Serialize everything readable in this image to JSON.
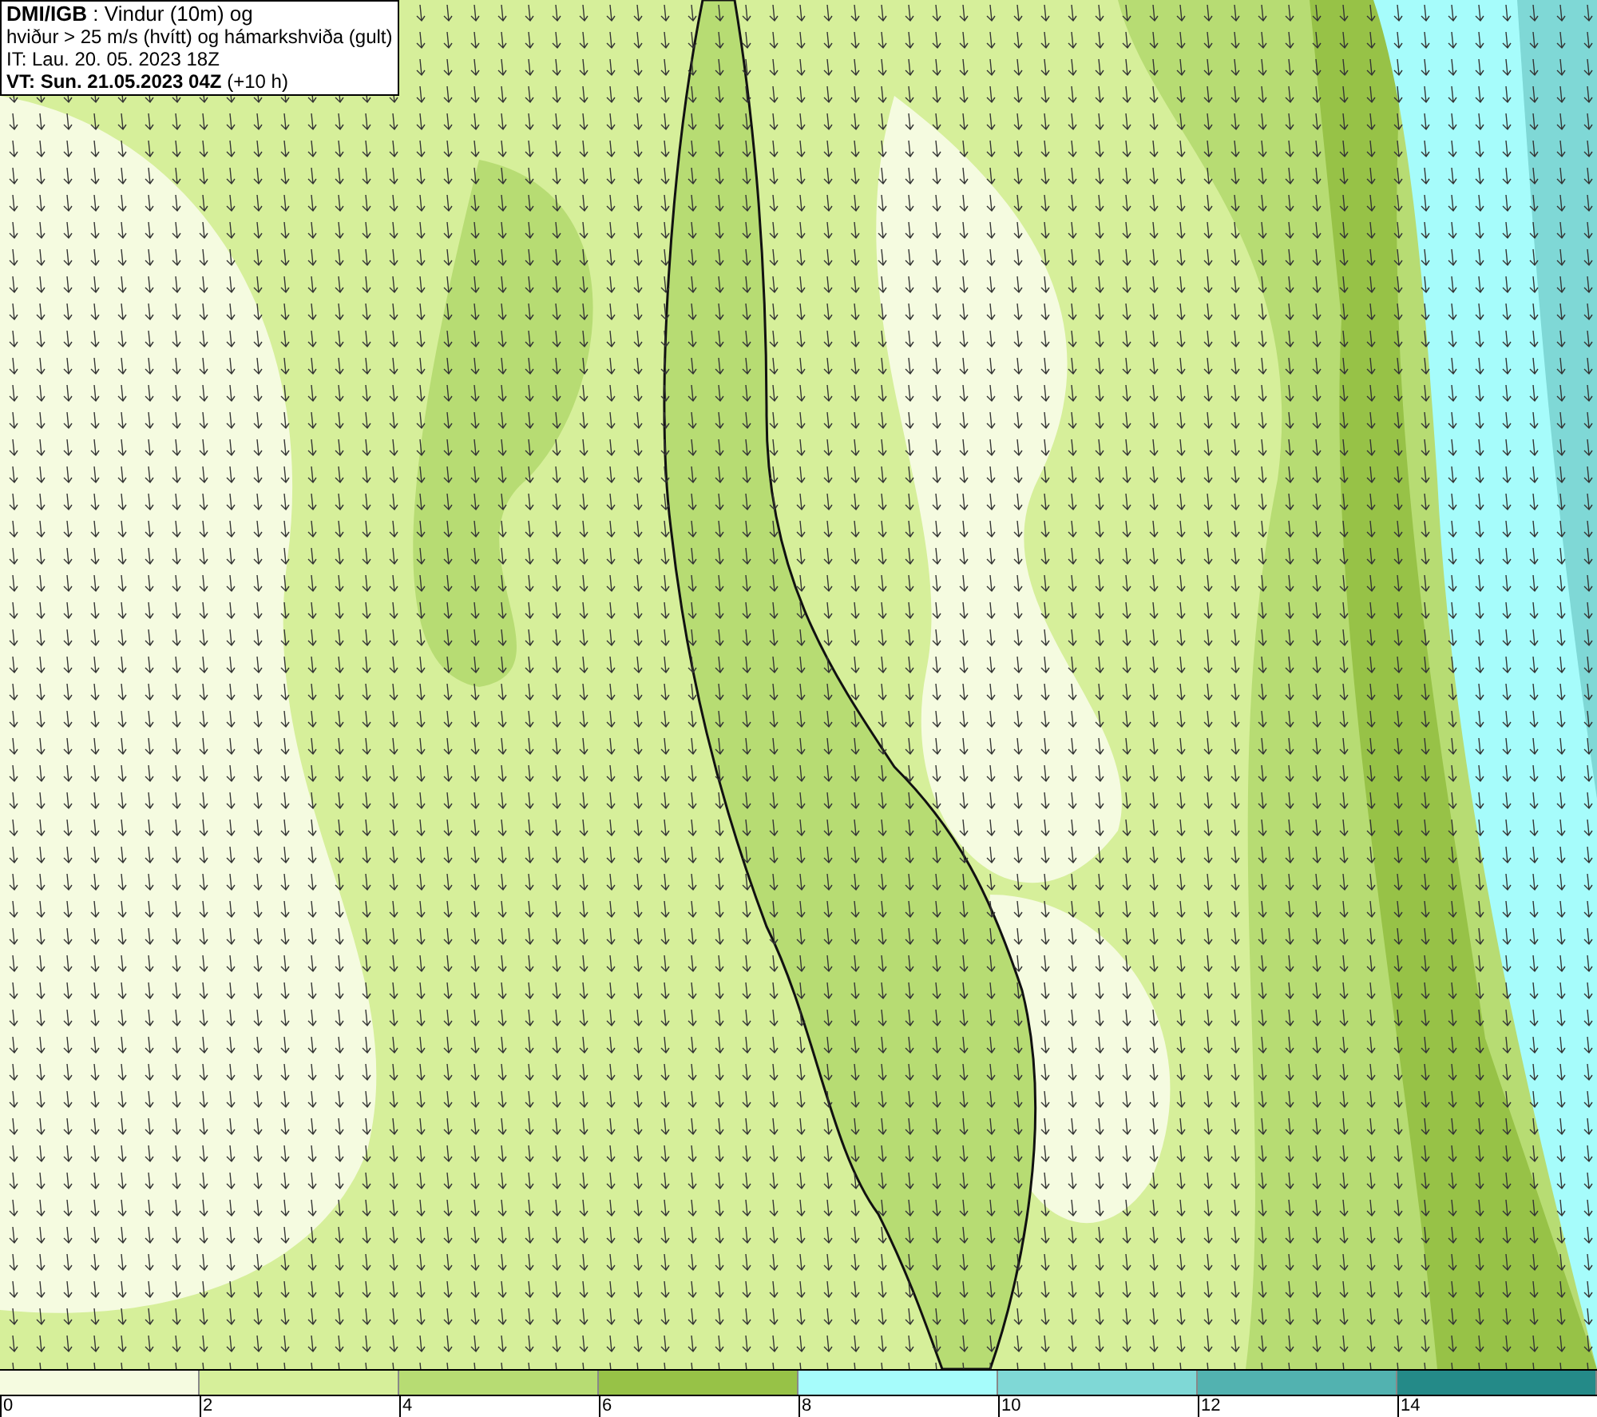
{
  "header": {
    "lines": [
      "**DMI/IGB** : Vindur (10m) og",
      "hviður > 25 m/s (hvítt) og hámarkshviða (gult)",
      "IT: Lau. 20. 05. 2023 18Z",
      "**VT: Sun. 21.05.2023 04Z** (+10 h)"
    ]
  },
  "legend": {
    "bins": [
      {
        "color": "#f5fbe0",
        "label": "0"
      },
      {
        "color": "#d6ef9a",
        "label": "2"
      },
      {
        "color": "#b7dc73",
        "label": "4"
      },
      {
        "color": "#97c247",
        "label": "6"
      },
      {
        "color": "#a6fcfb",
        "label": "8"
      },
      {
        "color": "#7fd8d6",
        "label": "10"
      },
      {
        "color": "#52b2b0",
        "label": "12"
      },
      {
        "color": "#248a88",
        "label": "14"
      }
    ]
  }
}
